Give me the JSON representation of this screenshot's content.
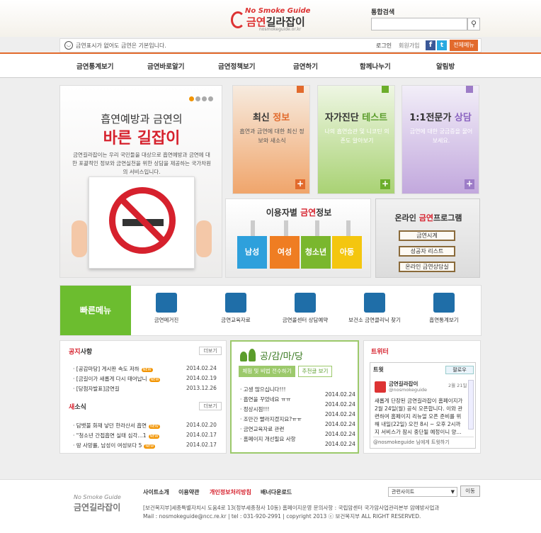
{
  "header": {
    "logo_en": "No Smoke Guide",
    "logo_ko_a": "금연",
    "logo_ko_b": "길라잡이",
    "logo_url": "nosmokeguide.or.kr",
    "search_label": "통합검색",
    "search_placeholder": ""
  },
  "topbar": {
    "notice": "금연표시가 없어도 금연은 기본입니다.",
    "login": "로그인",
    "join": "회원가입",
    "all_menu": "전체메뉴"
  },
  "nav": [
    "금연통계보기",
    "금연바로알기",
    "금연정책보기",
    "금연하기",
    "함께나누기",
    "알림방"
  ],
  "hero": {
    "line1": "흡연예방과 금연의",
    "line2": "바른 길잡이",
    "desc": "금연길라잡이는 우리 국민들을 대상으로 흡연예방과 금연에 대한 포괄적인 정보와 금연실천을 위한 상담을 제공하는 국가차원의 서비스입니다."
  },
  "cards": [
    {
      "title_a": "최신 ",
      "title_b": "정보",
      "desc": "흡연과 금연에 대한 최신 정보와 새소식",
      "color": "#e26a2c"
    },
    {
      "title_a": "자가진단 ",
      "title_b": "테스트",
      "desc": "나의 흡연습관 및 니코틴 의존도 알아보기",
      "color": "#6cae2b"
    },
    {
      "title_a": "1:1전문가 ",
      "title_b": "상담",
      "desc": "금연에 대한 궁금증을 물어보세요.",
      "color": "#9d7cc7"
    }
  ],
  "user_info": {
    "title_a": "이용자별 ",
    "title_b": "금연",
    "title_c": "정보",
    "blocks": [
      {
        "label": "남성",
        "color": "#2ea0dc"
      },
      {
        "label": "여성",
        "color": "#ef7d22"
      },
      {
        "label": "청소년",
        "color": "#7ab72e"
      },
      {
        "label": "아동",
        "color": "#f4c60f"
      }
    ]
  },
  "program": {
    "title_a": "온라인 ",
    "title_b": "금연",
    "title_c": "프로그램",
    "buttons": [
      "금연시계",
      "성공자 리스트",
      "온라인 금연상담실"
    ]
  },
  "quick": {
    "title": "빠른메뉴",
    "items": [
      "금연메거진",
      "금연교육자료",
      "금연콜센터 상담예약",
      "보건소 금연클리닉 찾기",
      "흡연통계보기"
    ]
  },
  "notice_panel": {
    "title_a": "공지",
    "title_b": "사항",
    "more": "더보기",
    "items": [
      {
        "text": "· [공감마당] 게시판 속도 저하",
        "date": "2014.02.24",
        "new": "NEW"
      },
      {
        "text": "· [금길이가 새롭게 다시 태어납니",
        "date": "2014.02.19",
        "new": "NEW"
      },
      {
        "text": "· [당첨자발표]금연길",
        "date": "2013.12.26",
        "new": ""
      }
    ]
  },
  "news_panel": {
    "title_a": "새",
    "title_b": "소식",
    "more": "더보기",
    "items": [
      {
        "text": "· 담뱃불 화재 낳던 한라산서 흡연",
        "date": "2014.02.20",
        "new": "NEW"
      },
      {
        "text": "· \"청소년 간접흡연 실태 심각…1",
        "date": "2014.02.17",
        "new": "NEW"
      },
      {
        "text": "· 땅 사망률, 남성이 여성보다 5",
        "date": "2014.02.17",
        "new": "NEW"
      }
    ]
  },
  "board": {
    "title": "공/감/마/당",
    "tab1": "체험 및 비법 전수하기",
    "tab2": "추천글 보기",
    "items": [
      {
        "text": "· 고생 많으십니다!!!",
        "date": "2014.02.24"
      },
      {
        "text": "· 흡연을 꾸었네요 ㅠㅠ",
        "date": "2014.02.24"
      },
      {
        "text": "· 정상시점!!!",
        "date": "2014.02.24"
      },
      {
        "text": "· 조만간 빨라지겠지요?ㅠㅠ",
        "date": "2014.02.24"
      },
      {
        "text": "· 금연교육자료 관련",
        "date": "2014.02.24"
      },
      {
        "text": "· 홈페이지 개선필요 사항",
        "date": "2014.02.24"
      }
    ]
  },
  "twitter": {
    "title": "트위터",
    "header": "트윗",
    "follow": "팔로우",
    "name": "금연길라잡이",
    "handle": "@nosmokeguide",
    "date": "2월 21일",
    "text": "새롭게 단장된 금연길라잡이 홈페이지가 2월 24일(월) 공식 오픈합니다. 이와 관련하여 홈페이지 리뉴얼 오픈 준비를 위해 내일(22일) 오전 8시 ~ 오후 2시까지 서비스가 잠시 중단될 예정이니 양...",
    "reply": "@nosmokeguide 님에게 트윗하기"
  },
  "footer": {
    "logo_en": "No Smoke Guide",
    "logo_ko": "금연길라잡이",
    "links": [
      "사이트소개",
      "이용약관",
      "개인정보처리방침",
      "배너다운로드"
    ],
    "address": "[보건복지부]세종특별자치시 도움4로 13(정부세종청사 10동) 홈페이지운영 문의사항 : 국립암센터 국가암사업관리본부 암예방사업과",
    "mail": "Mail : nosmokeguide@ncc.re.kr | tel : 031-920-2991 | copyright 2013 ⓒ 보건복지부 ALL RIGHT RESERVED.",
    "related": "관련사이트",
    "go": "이동"
  }
}
